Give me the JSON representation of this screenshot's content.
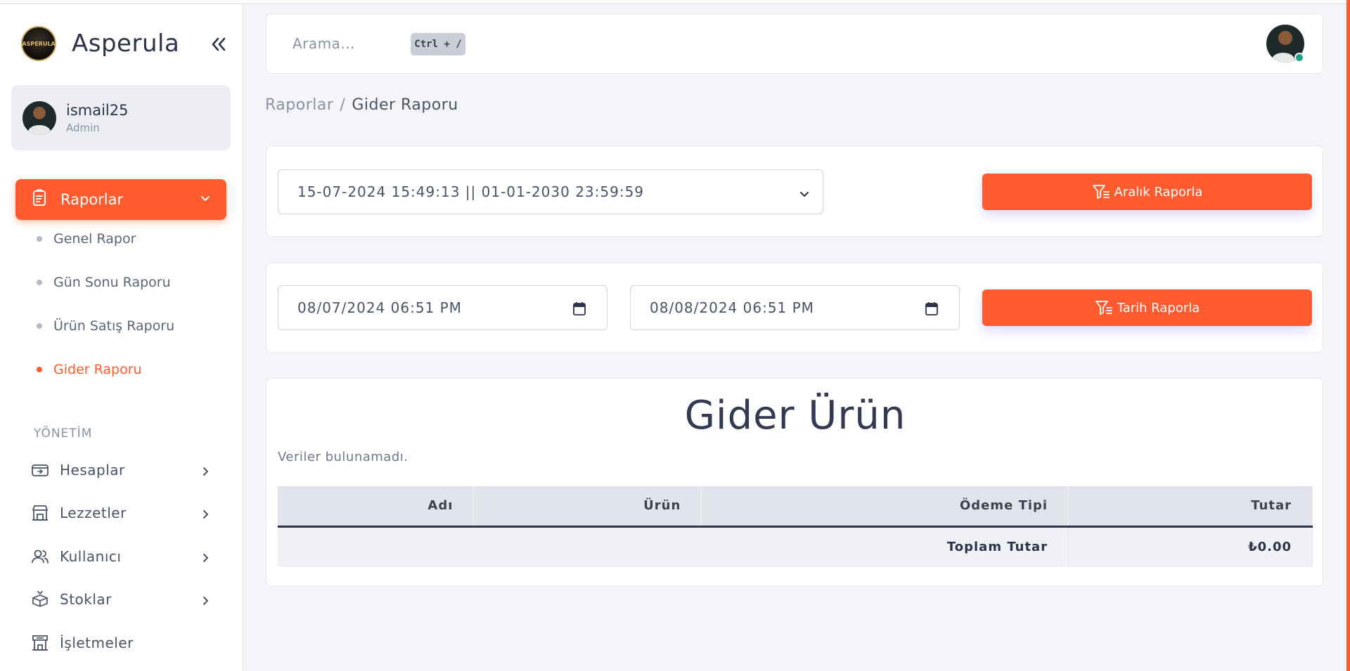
{
  "app": {
    "brand": "Asperula",
    "logo_text": "ASPERULA",
    "accent_color": "#ff5b2e"
  },
  "user": {
    "name": "ismail25",
    "role": "Admin"
  },
  "sidebar": {
    "active_menu": {
      "label": "Raporlar",
      "icon": "report-icon"
    },
    "sub_items": [
      {
        "label": "Genel Rapor",
        "active": false
      },
      {
        "label": "Gün Sonu Raporu",
        "active": false
      },
      {
        "label": "Ürün Satış Raporu",
        "active": false
      },
      {
        "label": "Gider Raporu",
        "active": true
      }
    ],
    "section_header": "YÖNETİM",
    "items": [
      {
        "label": "Hesaplar",
        "icon": "wallet-icon"
      },
      {
        "label": "Lezzetler",
        "icon": "store-icon"
      },
      {
        "label": "Kullanıcı",
        "icon": "users-icon"
      },
      {
        "label": "Stoklar",
        "icon": "box-icon"
      },
      {
        "label": "İşletmeler",
        "icon": "building-icon"
      }
    ]
  },
  "topbar": {
    "search_placeholder": "Arama...",
    "shortcut": "Ctrl + /"
  },
  "breadcrumb": {
    "parent": "Raporlar",
    "separator": "/",
    "current": "Gider Raporu"
  },
  "range_filter": {
    "selected_range": "15-07-2024 15:49:13 || 01-01-2030 23:59:59",
    "button_label": "Aralık Raporla"
  },
  "date_filter": {
    "start_date": "08/07/2024 06:51 PM",
    "end_date": "08/08/2024 06:51 PM",
    "button_label": "Tarih Raporla"
  },
  "report": {
    "title": "Gider Ürün",
    "empty_message": "Veriler bulunamadı.",
    "columns": [
      "Adı",
      "Ürün",
      "Ödeme Tipi",
      "Tutar"
    ],
    "total_label": "Toplam Tutar",
    "total_value": "₺0.00"
  }
}
